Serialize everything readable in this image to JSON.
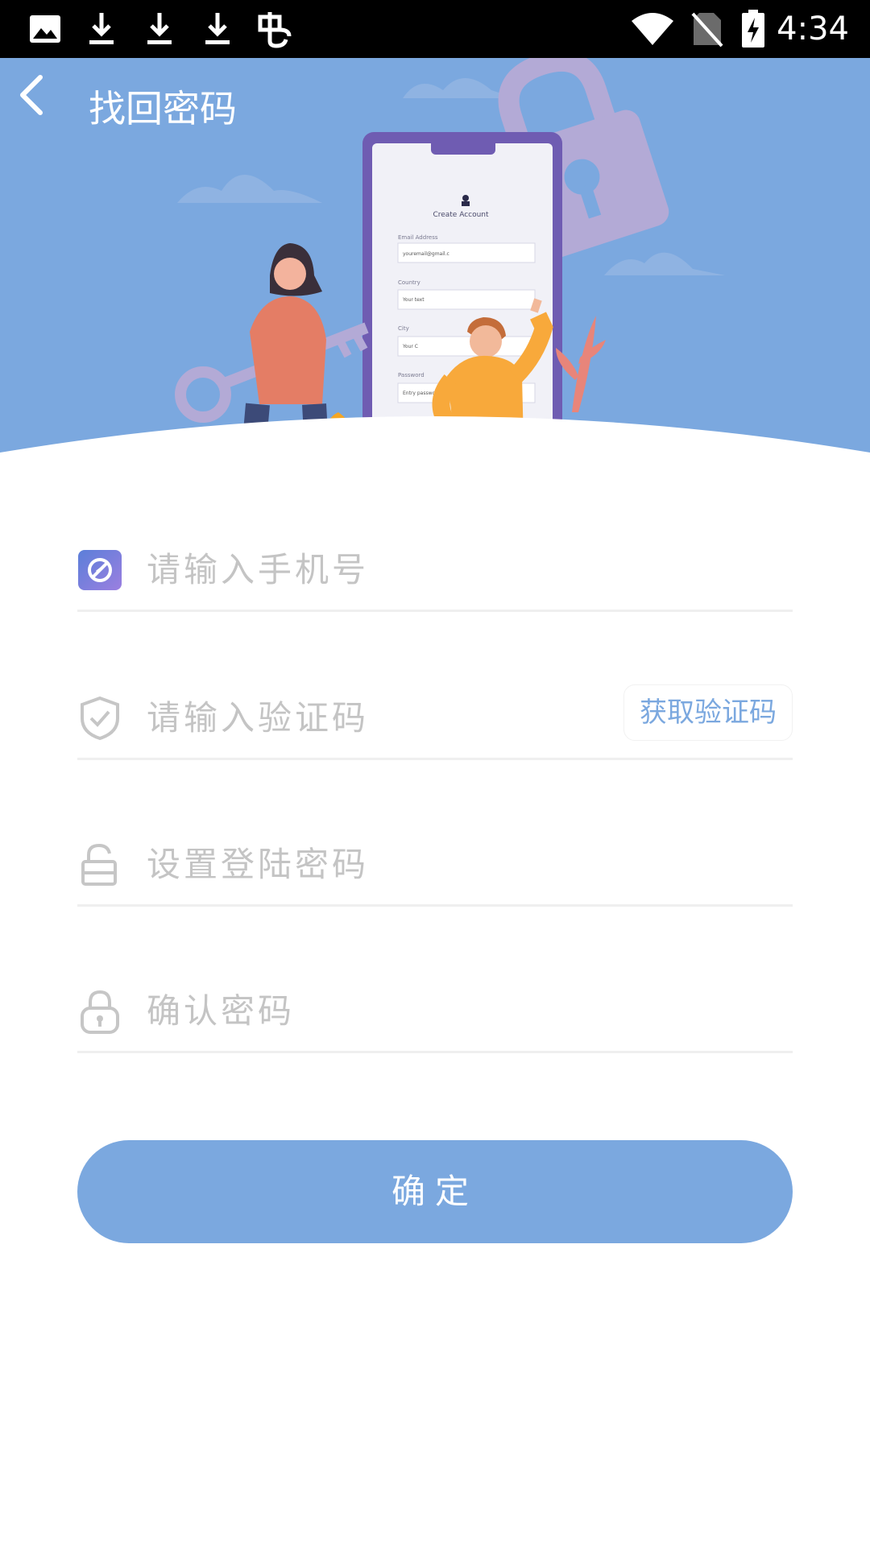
{
  "status_bar": {
    "time": "4:34",
    "left_icons": [
      "image-icon",
      "download-icon",
      "download-icon",
      "download-icon",
      "app-notification-icon"
    ],
    "right_icons": [
      "wifi-icon",
      "no-sim-icon",
      "battery-charging-icon"
    ]
  },
  "header": {
    "title": "找回密码",
    "back_icon": "chevron-left-icon"
  },
  "hero_illustration": {
    "card_title": "Create Account",
    "email_label": "Email Address",
    "email_value": "youremail@gmail.c",
    "country_label": "Country",
    "country_value": "Your text",
    "city_label": "City",
    "city_value": "Your C",
    "password_label": "Password",
    "password_value": "Entry password"
  },
  "form": {
    "phone": {
      "placeholder": "请输入手机号",
      "icon": "phone-badge-icon"
    },
    "code": {
      "placeholder": "请输入验证码",
      "icon": "shield-check-icon",
      "button_label": "获取验证码"
    },
    "password": {
      "placeholder": "设置登陆密码",
      "icon": "unlock-icon"
    },
    "confirm": {
      "placeholder": "确认密码",
      "icon": "lock-icon"
    },
    "submit_label": "确定"
  },
  "colors": {
    "accent": "#7ba8df",
    "status_bar": "#000000",
    "divider": "#efefef",
    "placeholder": "#c4c4c4"
  }
}
